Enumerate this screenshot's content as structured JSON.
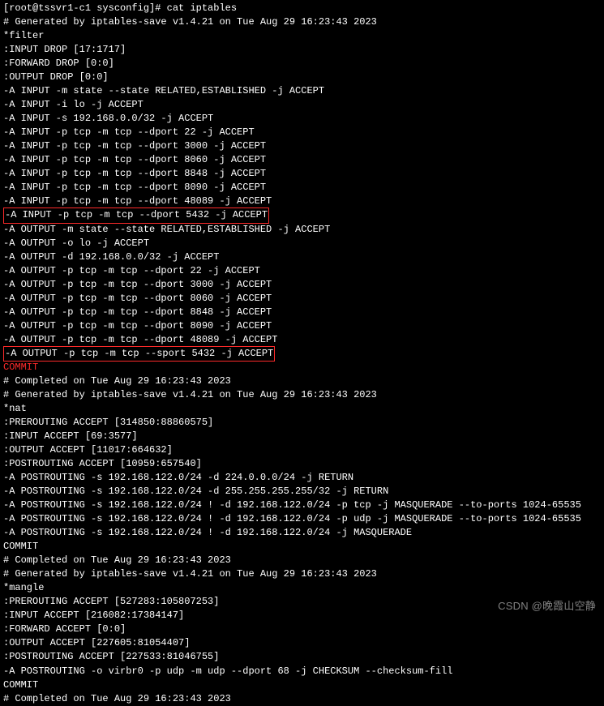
{
  "prompt": "[root@tssvr1-c1 sysconfig]# cat iptables",
  "filter": {
    "header": "# Generated by iptables-save v1.4.21 on Tue Aug 29 16:23:43 2023",
    "table": "*filter",
    "chains": [
      ":INPUT DROP [17:1717]",
      ":FORWARD DROP [0:0]",
      ":OUTPUT DROP [0:0]"
    ],
    "rules_input": [
      "-A INPUT -m state --state RELATED,ESTABLISHED -j ACCEPT",
      "-A INPUT -i lo -j ACCEPT",
      "-A INPUT -s 192.168.0.0/32 -j ACCEPT",
      "-A INPUT -p tcp -m tcp --dport 22 -j ACCEPT",
      "-A INPUT -p tcp -m tcp --dport 3000 -j ACCEPT",
      "-A INPUT -p tcp -m tcp --dport 8060 -j ACCEPT",
      "-A INPUT -p tcp -m tcp --dport 8848 -j ACCEPT",
      "-A INPUT -p tcp -m tcp --dport 8090 -j ACCEPT",
      "-A INPUT -p tcp -m tcp --dport 48089 -j ACCEPT"
    ],
    "highlight_input": "-A INPUT -p tcp -m tcp --dport 5432 -j ACCEPT",
    "rules_output": [
      "-A OUTPUT -m state --state RELATED,ESTABLISHED -j ACCEPT",
      "-A OUTPUT -o lo -j ACCEPT",
      "-A OUTPUT -d 192.168.0.0/32 -j ACCEPT",
      "-A OUTPUT -p tcp -m tcp --dport 22 -j ACCEPT",
      "-A OUTPUT -p tcp -m tcp --dport 3000 -j ACCEPT",
      "-A OUTPUT -p tcp -m tcp --dport 8060 -j ACCEPT",
      "-A OUTPUT -p tcp -m tcp --dport 8848 -j ACCEPT",
      "-A OUTPUT -p tcp -m tcp --dport 8090 -j ACCEPT",
      "-A OUTPUT -p tcp -m tcp --dport 48089 -j ACCEPT"
    ],
    "highlight_output": "-A OUTPUT -p tcp -m tcp --sport 5432 -j ACCEPT",
    "commit": "COMMIT",
    "footer": "# Completed on Tue Aug 29 16:23:43 2023"
  },
  "nat": {
    "header": "# Generated by iptables-save v1.4.21 on Tue Aug 29 16:23:43 2023",
    "table": "*nat",
    "chains": [
      ":PREROUTING ACCEPT [314850:88860575]",
      ":INPUT ACCEPT [69:3577]",
      ":OUTPUT ACCEPT [11017:664632]",
      ":POSTROUTING ACCEPT [10959:657540]"
    ],
    "rules": [
      "-A POSTROUTING -s 192.168.122.0/24 -d 224.0.0.0/24 -j RETURN",
      "-A POSTROUTING -s 192.168.122.0/24 -d 255.255.255.255/32 -j RETURN",
      "-A POSTROUTING -s 192.168.122.0/24 ! -d 192.168.122.0/24 -p tcp -j MASQUERADE --to-ports 1024-65535",
      "-A POSTROUTING -s 192.168.122.0/24 ! -d 192.168.122.0/24 -p udp -j MASQUERADE --to-ports 1024-65535",
      "-A POSTROUTING -s 192.168.122.0/24 ! -d 192.168.122.0/24 -j MASQUERADE"
    ],
    "commit": "COMMIT",
    "footer": "# Completed on Tue Aug 29 16:23:43 2023"
  },
  "mangle": {
    "header": "# Generated by iptables-save v1.4.21 on Tue Aug 29 16:23:43 2023",
    "table": "*mangle",
    "chains": [
      ":PREROUTING ACCEPT [527283:105807253]",
      ":INPUT ACCEPT [216082:17384147]",
      ":FORWARD ACCEPT [0:0]",
      ":OUTPUT ACCEPT [227605:81054407]",
      ":POSTROUTING ACCEPT [227533:81046755]"
    ],
    "rules": [
      "-A POSTROUTING -o virbr0 -p udp -m udp --dport 68 -j CHECKSUM --checksum-fill"
    ],
    "commit": "COMMIT",
    "footer": "# Completed on Tue Aug 29 16:23:43 2023"
  },
  "watermark": "CSDN @晚霞山空静"
}
